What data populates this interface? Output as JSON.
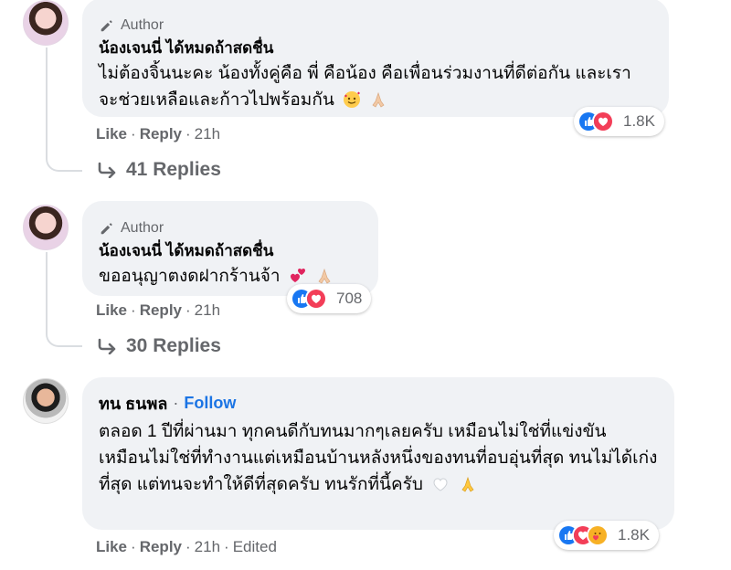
{
  "comments": [
    {
      "badge": "Author",
      "name": "น้องเจนนี่ ได้หมดถ้าสดชื่น",
      "text": "ไม่ต้องจิ้นนะคะ น้องทั้งคู่คือ พี่ คือน้อง คือเพื่อนร่วมงานที่ดีต่อกัน และเราจะช่วยเหลือและก้าวไปพร้อมกัน",
      "reaction_count": "1.8K",
      "like": "Like",
      "reply": "Reply",
      "time": "21h",
      "replies": "41 Replies"
    },
    {
      "badge": "Author",
      "name": "น้องเจนนี่ ได้หมดถ้าสดชื่น",
      "text": "ขออนุญาตงดฝากร้านจ้า",
      "reaction_count": "708",
      "like": "Like",
      "reply": "Reply",
      "time": "21h",
      "replies": "30 Replies"
    },
    {
      "name": "ทน ธนพล",
      "follow": "Follow",
      "text": "ตลอด 1 ปีที่ผ่านมา ทุกคนดีกับทนมากๆเลยครับ เหมือนไม่ใช่ที่แข่งขัน เหมือนไม่ใช่ที่ทำงานแต่เหมือนบ้านหลังหนึ่งของทนที่อบอุ่นที่สุด ทนไม่ได้เก่งที่สุด แต่ทนจะทำให้ดีที่สุดครับ ทนรักที่นี้ครับ",
      "reaction_count": "1.8K",
      "like": "Like",
      "reply": "Reply",
      "time": "21h",
      "edited": "Edited"
    }
  ],
  "colors": {
    "bubble": "#f0f2f5",
    "muted": "#65676b",
    "link": "#1b74e4",
    "like_blue": "#1877f2",
    "love_red": "#f33e58"
  }
}
